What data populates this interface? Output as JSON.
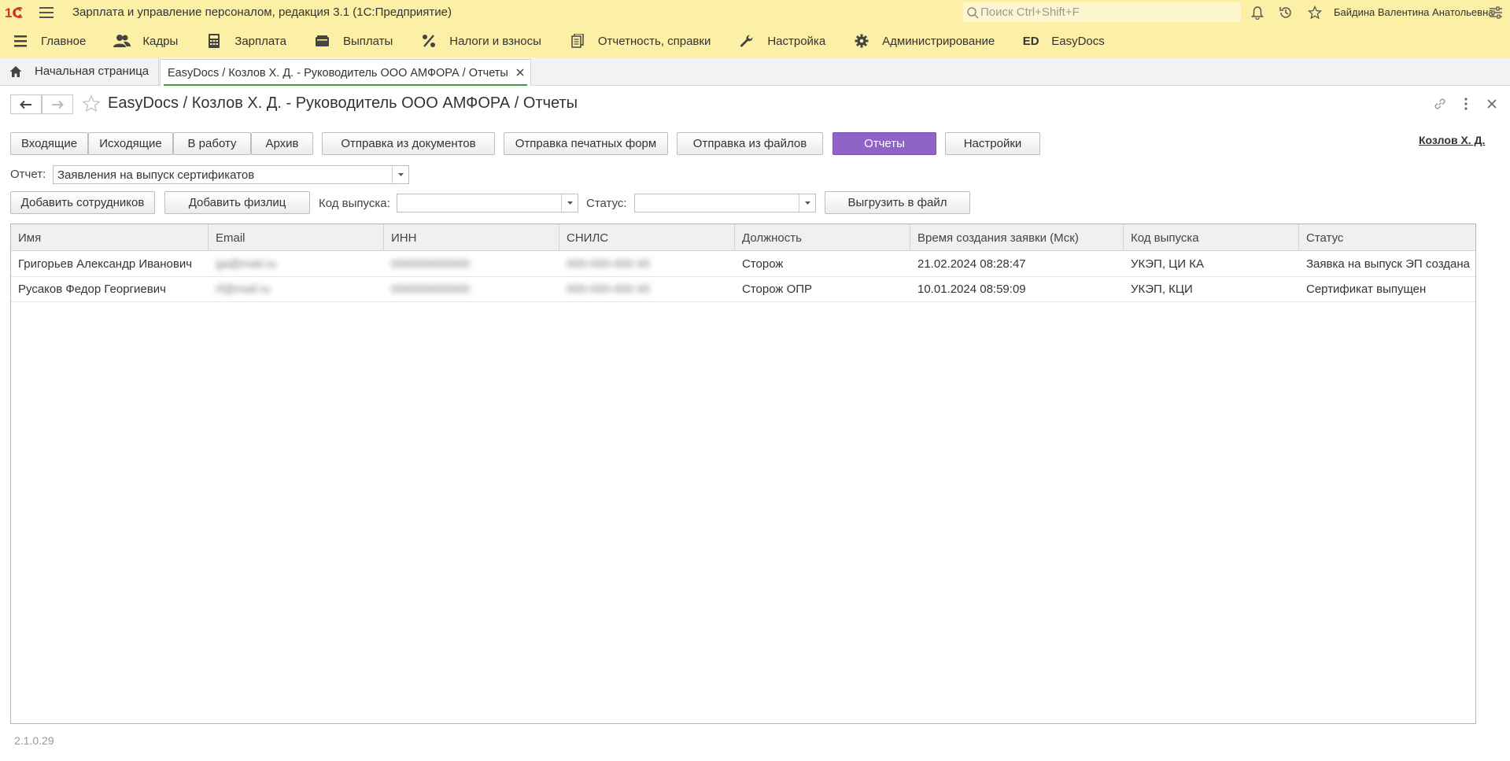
{
  "app": {
    "title": "Зарплата и управление персоналом, редакция 3.1  (1С:Предприятие)",
    "search_placeholder": "Поиск Ctrl+Shift+F",
    "user": "Байдина Валентина Анатольевна"
  },
  "sections": [
    {
      "label": "Главное",
      "icon": "menu-icon"
    },
    {
      "label": "Кадры",
      "icon": "people-icon"
    },
    {
      "label": "Зарплата",
      "icon": "calculator-icon"
    },
    {
      "label": "Выплаты",
      "icon": "wallet-icon"
    },
    {
      "label": "Налоги и взносы",
      "icon": "percent-icon"
    },
    {
      "label": "Отчетность, справки",
      "icon": "documents-icon"
    },
    {
      "label": "Настройка",
      "icon": "wrench-icon"
    },
    {
      "label": "Администрирование",
      "icon": "gear-icon"
    },
    {
      "label": "EasyDocs",
      "icon": "easydocs-icon",
      "icon_text": "ED"
    }
  ],
  "tabs": {
    "home": "Начальная страница",
    "active": "EasyDocs / Козлов Х. Д. - Руководитель ООО АМФОРА / Отчеты"
  },
  "form": {
    "title": "EasyDocs / Козлов Х. Д. - Руководитель ООО АМФОРА / Отчеты",
    "user_link": "Козлов Х. Д."
  },
  "toolbar": {
    "incoming": "Входящие",
    "outgoing": "Исходящие",
    "in_work": "В работу",
    "archive": "Архив",
    "send_docs": "Отправка из документов",
    "send_print": "Отправка печатных форм",
    "send_files": "Отправка из файлов",
    "reports": "Отчеты",
    "settings": "Настройки"
  },
  "report": {
    "label": "Отчет:",
    "value": "Заявления на выпуск сертификатов"
  },
  "filters": {
    "add_employees": "Добавить сотрудников",
    "add_persons": "Добавить физлиц",
    "code_label": "Код выпуска:",
    "code_value": "",
    "status_label": "Статус:",
    "status_value": "",
    "export": "Выгрузить в файл"
  },
  "table": {
    "columns": [
      "Имя",
      "Email",
      "ИНН",
      "СНИЛС",
      "Должность",
      "Время создания заявки (Мск)",
      "Код выпуска",
      "Статус"
    ],
    "rows": [
      [
        "Григорьев Александр Иванович",
        "ga@mail.ru",
        "000000000000",
        "000-000-000 00",
        "Сторож",
        "21.02.2024 08:28:47",
        "УКЭП, ЦИ КА",
        "Заявка на выпуск ЭП создана"
      ],
      [
        "Русаков Федор Георгиевич",
        "rf@mail.ru",
        "000000000000",
        "000-000-000 00",
        "Сторож ОПР",
        "10.01.2024 08:59:09",
        "УКЭП, КЦИ",
        "Сертификат выпущен"
      ]
    ]
  },
  "version": "2.1.0.29",
  "colors": {
    "header_bg": "#fbf0a6",
    "accent_button": "#8f64c6",
    "tab_underline": "#3a9e3a"
  }
}
